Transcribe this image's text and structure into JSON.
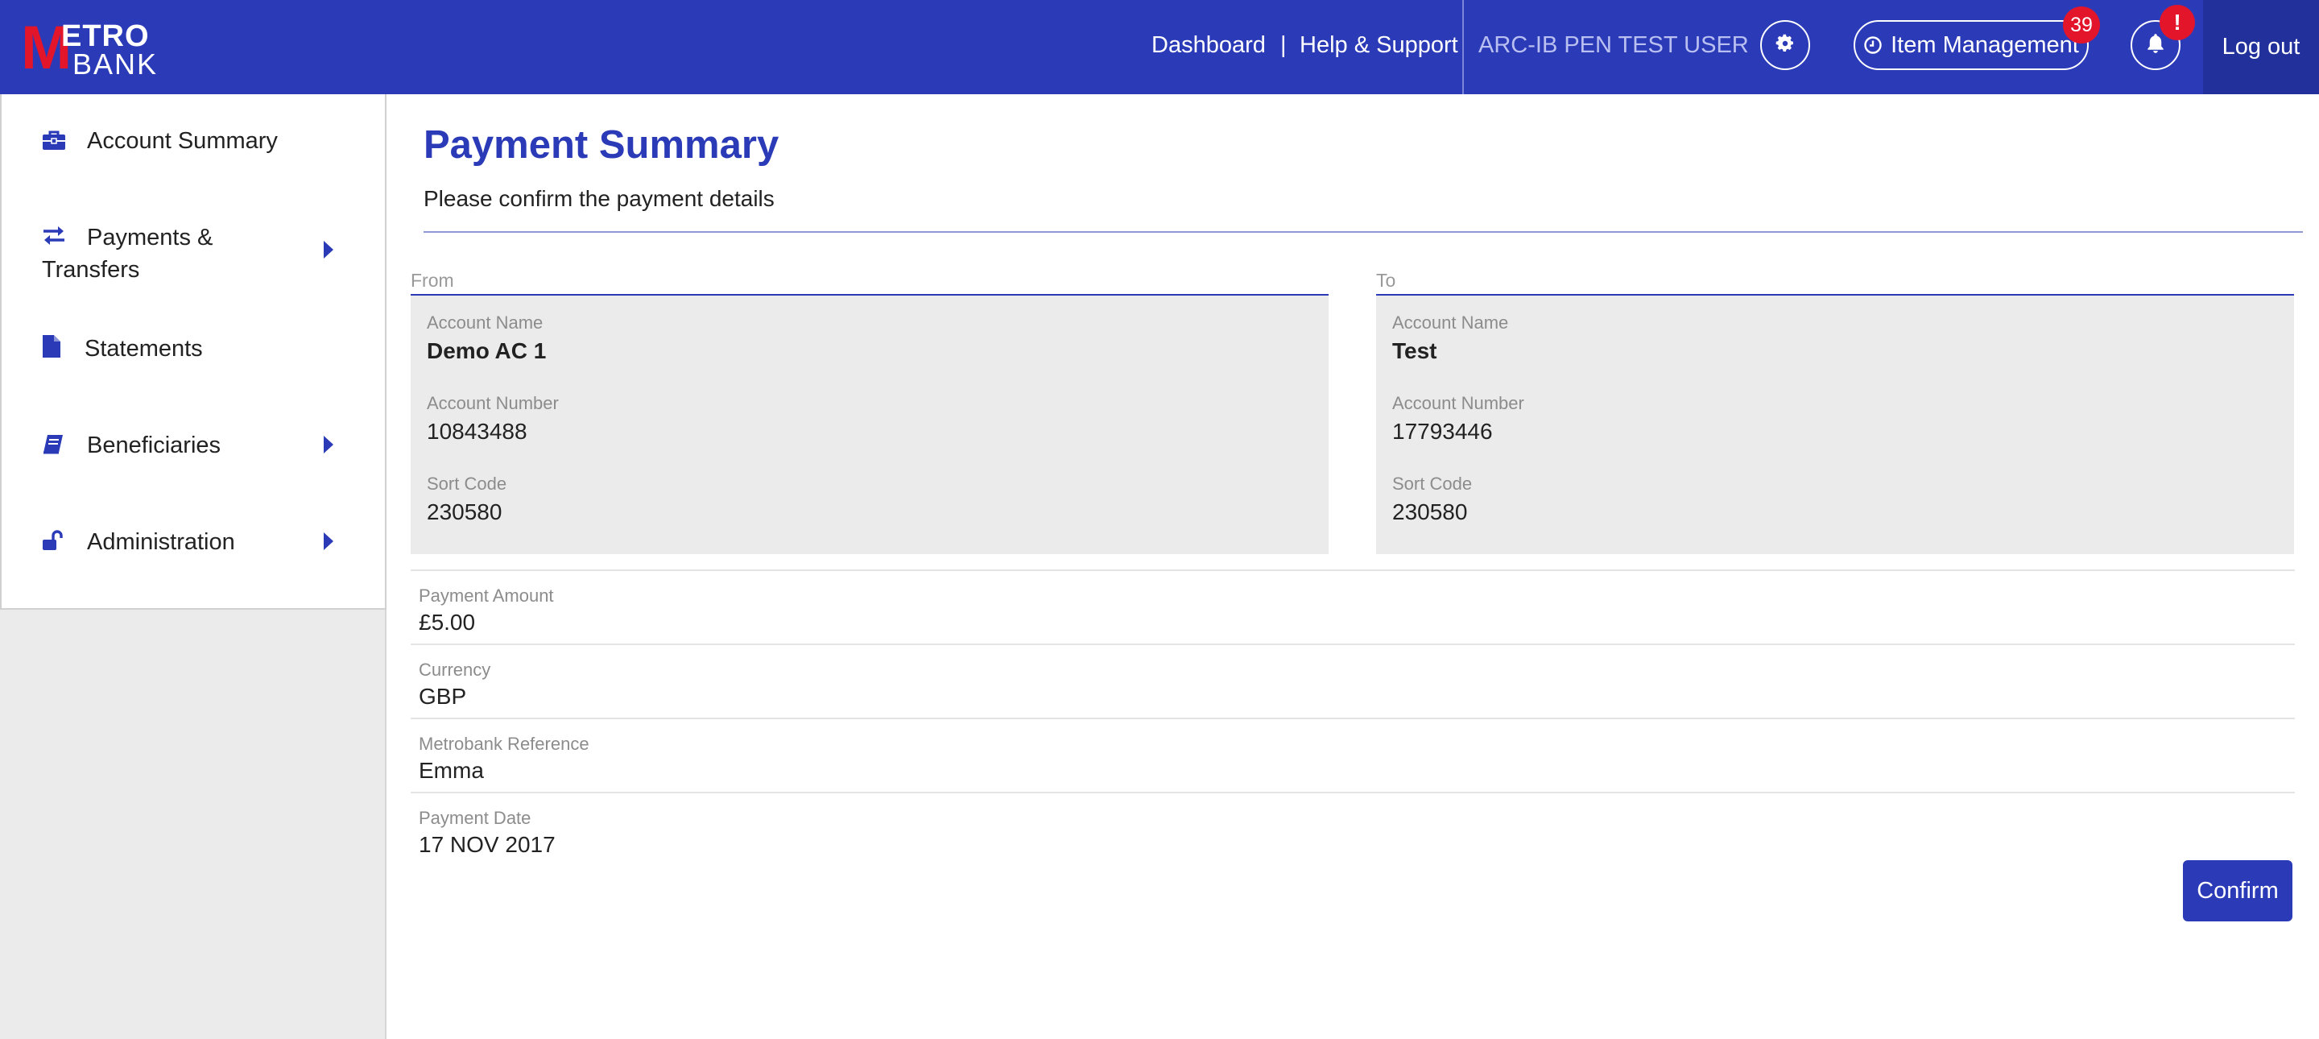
{
  "brand": {
    "logo_text": "METRO BANK",
    "primary": "#2b3bb8",
    "accent": "#e3152b"
  },
  "header": {
    "dashboard": "Dashboard",
    "separator": "|",
    "help": "Help & Support",
    "user": "ARC-IB PEN TEST USER",
    "settings_icon": "gear-icon",
    "item_management": "Item Management",
    "item_management_count": "39",
    "notifications_badge": "!",
    "logout": "Log out"
  },
  "sidebar": {
    "items": [
      {
        "label": "Account Summary",
        "icon": "briefcase-icon",
        "has_submenu": false
      },
      {
        "label": "Payments & Transfers",
        "label_line1": "Payments &",
        "label_line2": "Transfers",
        "icon": "transfer-arrows-icon",
        "has_submenu": true
      },
      {
        "label": "Statements",
        "icon": "document-icon",
        "has_submenu": false
      },
      {
        "label": "Beneficiaries",
        "icon": "address-book-icon",
        "has_submenu": true
      },
      {
        "label": "Administration",
        "icon": "unlock-icon",
        "has_submenu": true
      }
    ]
  },
  "main": {
    "title": "Payment Summary",
    "subtitle": "Please confirm the payment details",
    "from": {
      "caption": "From",
      "account_name_label": "Account Name",
      "account_name": "Demo AC 1",
      "account_number_label": "Account Number",
      "account_number": "10843488",
      "sort_code_label": "Sort Code",
      "sort_code": "230580"
    },
    "to": {
      "caption": "To",
      "account_name_label": "Account Name",
      "account_name": "Test",
      "account_number_label": "Account Number",
      "account_number": "17793446",
      "sort_code_label": "Sort Code",
      "sort_code": "230580"
    },
    "details": [
      {
        "label": "Payment Amount",
        "value": "£5.00"
      },
      {
        "label": "Currency",
        "value": "GBP"
      },
      {
        "label": "Metrobank Reference",
        "value": "Emma"
      },
      {
        "label": "Payment Date",
        "value": "17 NOV 2017"
      }
    ],
    "confirm": "Confirm"
  }
}
